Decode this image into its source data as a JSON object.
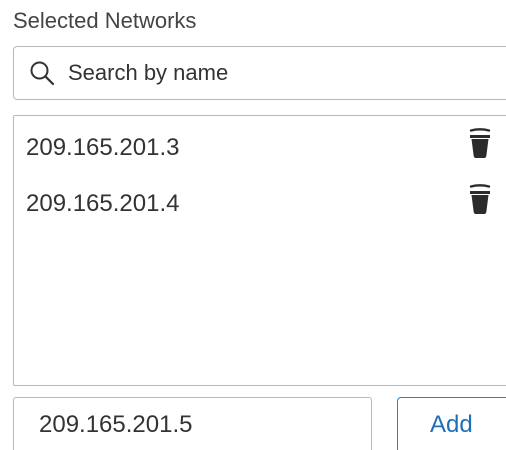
{
  "section": {
    "title": "Selected Networks"
  },
  "search": {
    "placeholder": "Search by name",
    "value": "",
    "icon": "search-icon"
  },
  "networks": [
    {
      "address": "209.165.201.3",
      "action_icon": "trash-icon"
    },
    {
      "address": "209.165.201.4",
      "action_icon": "trash-icon"
    }
  ],
  "add_form": {
    "input_value": "209.165.201.5",
    "add_label": "Add"
  },
  "colors": {
    "accent": "#1f6fb8",
    "border": "#b8b8b8",
    "text": "#333333",
    "icon": "#2b2b2b"
  }
}
